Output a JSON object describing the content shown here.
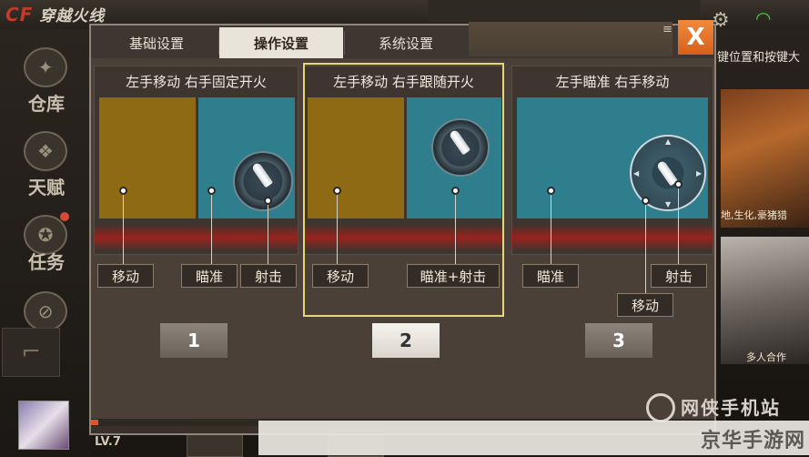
{
  "background": {
    "logo_text": "CF",
    "logo_sub": "穿越火线",
    "sidebar": [
      {
        "label": "仓库",
        "icon": "warehouse-icon"
      },
      {
        "label": "天赋",
        "icon": "talent-icon"
      },
      {
        "label": "任务",
        "icon": "task-icon"
      }
    ],
    "player_level": "LV.7",
    "right_text": "键位置和按键大",
    "right_card1_text": "地,生化,豪猪猎",
    "right_card2_text": "多人合作",
    "accent_wifi": "#4ad04a"
  },
  "dialog": {
    "tabs": [
      {
        "label": "基础设置",
        "active": false
      },
      {
        "label": "操作设置",
        "active": true
      },
      {
        "label": "系统设置",
        "active": false
      }
    ],
    "close_label": "X",
    "menu_label": "≡"
  },
  "schemes": [
    {
      "title": "左手移动 右手固定开火",
      "labels": {
        "move": "移动",
        "aim": "瞄准",
        "fire": "射击"
      },
      "button": "1",
      "selected": false
    },
    {
      "title": "左手移动 右手跟随开火",
      "labels": {
        "move": "移动",
        "aim_fire": "瞄准+射击"
      },
      "button": "2",
      "selected": true
    },
    {
      "title": "左手瞄准 右手移动",
      "labels": {
        "aim": "瞄准",
        "fire": "射击",
        "move": "移动"
      },
      "button": "3",
      "selected": false
    }
  ],
  "watermark": {
    "top": "网侠手机站",
    "bottom": "京华手游网"
  },
  "colors": {
    "gold_area": "#8e6a14",
    "teal_area": "#2e7e8e",
    "selected_frame": "#e7d57a",
    "close_button": "#e8742a"
  }
}
